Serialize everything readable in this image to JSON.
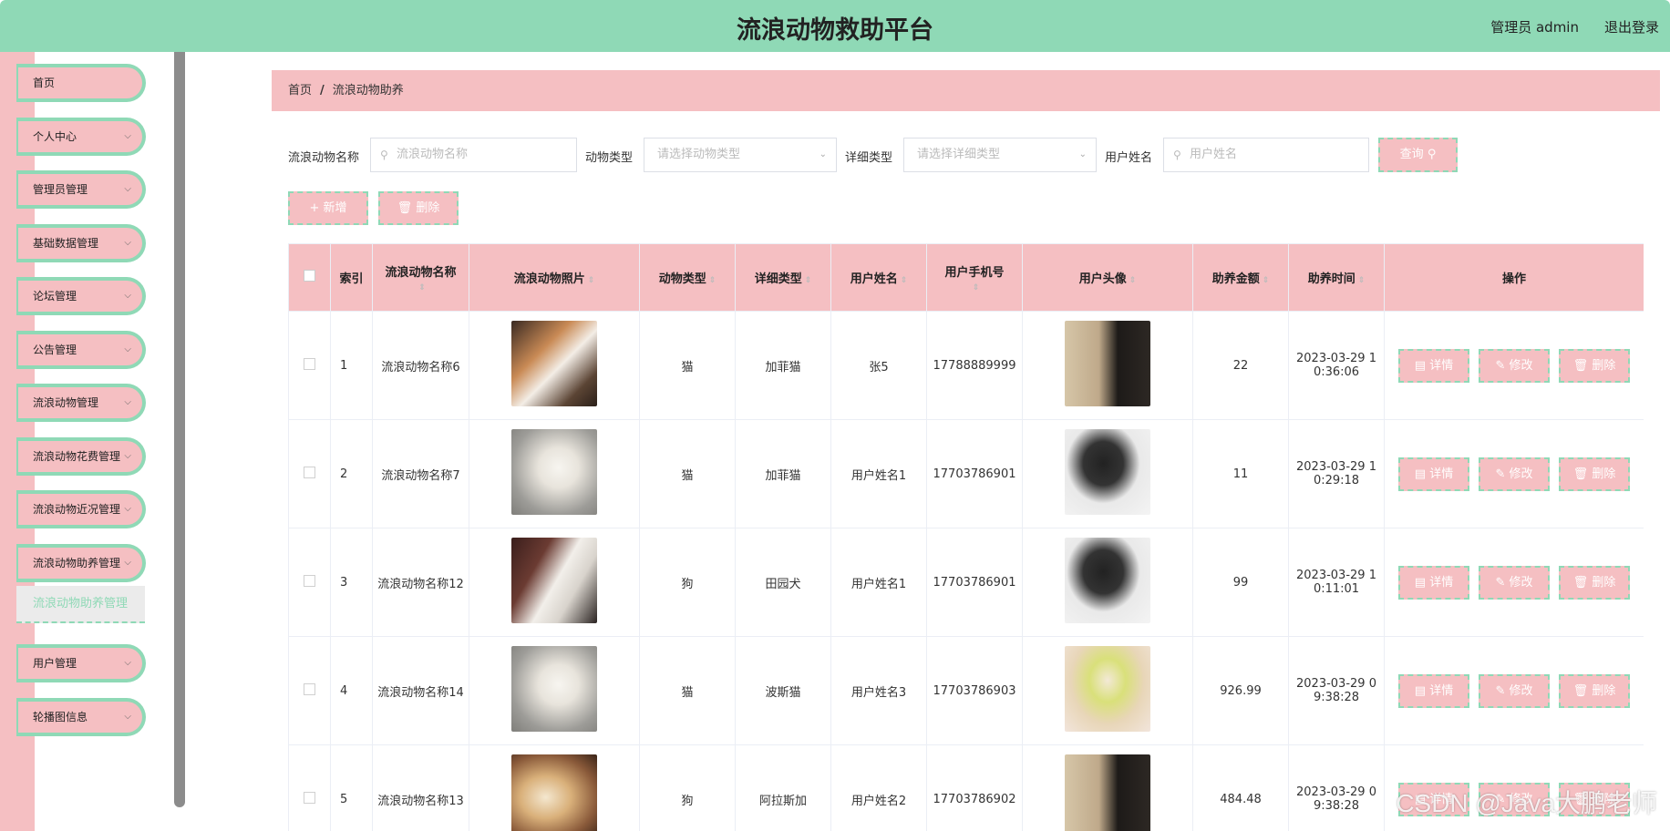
{
  "header": {
    "title": "流浪动物救助平台",
    "user": "管理员 admin",
    "logout": "退出登录"
  },
  "sidebar": {
    "items": [
      {
        "label": "首页",
        "has_arrow": false
      },
      {
        "label": "个人中心",
        "has_arrow": true
      },
      {
        "label": "管理员管理",
        "has_arrow": true
      },
      {
        "label": "基础数据管理",
        "has_arrow": true
      },
      {
        "label": "论坛管理",
        "has_arrow": true
      },
      {
        "label": "公告管理",
        "has_arrow": true
      },
      {
        "label": "流浪动物管理",
        "has_arrow": true
      },
      {
        "label": "流浪动物花费管理",
        "has_arrow": true
      },
      {
        "label": "流浪动物近况管理",
        "has_arrow": true
      },
      {
        "label": "流浪动物助养管理",
        "has_arrow": true
      },
      {
        "label": "用户管理",
        "has_arrow": true
      },
      {
        "label": "轮播图信息",
        "has_arrow": true
      }
    ],
    "active_sub": "流浪动物助养管理"
  },
  "breadcrumb": {
    "home": "首页",
    "sep": "/",
    "current": "流浪动物助养"
  },
  "search": {
    "name_label": "流浪动物名称",
    "name_placeholder": "流浪动物名称",
    "type_label": "动物类型",
    "type_placeholder": "请选择动物类型",
    "detail_label": "详细类型",
    "detail_placeholder": "请选择详细类型",
    "user_label": "用户姓名",
    "user_placeholder": "用户姓名",
    "query": "查询"
  },
  "actions": {
    "add": "新增",
    "delete": "删除"
  },
  "table": {
    "columns": [
      "索引",
      "流浪动物名称",
      "流浪动物照片",
      "动物类型",
      "详细类型",
      "用户姓名",
      "用户手机号",
      "用户头像",
      "助养金额",
      "助养时间",
      "操作"
    ],
    "op_labels": {
      "detail": "详情",
      "edit": "修改",
      "delete": "删除"
    },
    "rows": [
      {
        "index": "1",
        "name": "流浪动物名称6",
        "photo": "dog-corgi-photo",
        "type": "猫",
        "detail": "加菲猫",
        "user": "张5",
        "phone": "17788889999",
        "avatar": "avatar-painting",
        "amount": "22",
        "time": "2023-03-29 10:36:06"
      },
      {
        "index": "2",
        "name": "流浪动物名称7",
        "photo": "white-puppy-photo",
        "type": "猫",
        "detail": "加菲猫",
        "user": "用户姓名1",
        "phone": "17703786901",
        "avatar": "avatar-man-bw",
        "amount": "11",
        "time": "2023-03-29 10:29:18"
      },
      {
        "index": "3",
        "name": "流浪动物名称12",
        "photo": "white-cat-photo",
        "type": "狗",
        "detail": "田园犬",
        "user": "用户姓名1",
        "phone": "17703786901",
        "avatar": "avatar-man-bw",
        "amount": "99",
        "time": "2023-03-29 10:11:01"
      },
      {
        "index": "4",
        "name": "流浪动物名称14",
        "photo": "white-puppy-photo",
        "type": "猫",
        "detail": "波斯猫",
        "user": "用户姓名3",
        "phone": "17703786903",
        "avatar": "avatar-anime-girl",
        "amount": "926.99",
        "time": "2023-03-29 09:38:28"
      },
      {
        "index": "5",
        "name": "流浪动物名称13",
        "photo": "golden-dog-photo",
        "type": "狗",
        "detail": "阿拉斯加",
        "user": "用户姓名2",
        "phone": "17703786902",
        "avatar": "avatar-painting",
        "amount": "484.48",
        "time": "2023-03-29 09:38:28"
      }
    ]
  },
  "watermark": "CSDN @Java大鹏老师",
  "colors": {
    "mint": "#8fd9b6",
    "pink": "#f5bfc2"
  }
}
